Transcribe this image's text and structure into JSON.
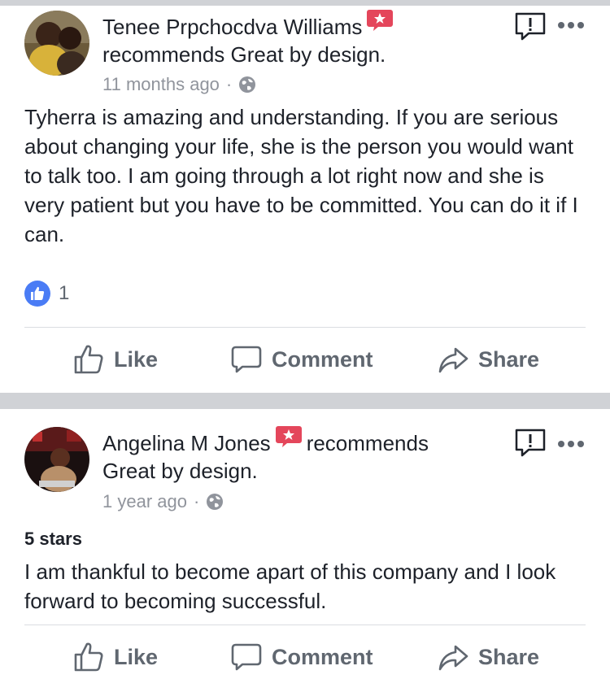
{
  "post1": {
    "author": "Tenee Prpchocdva Williams",
    "recommends_text": "recommends Great by design.",
    "time": "11 months ago",
    "separator": "·",
    "body": "Tyherra is amazing and understanding. If you are serious about changing your life, she is the person you would want to talk too. I am going through a lot right now and she is very patient but you have to be committed. You can do it if I can.",
    "reaction_count": "1"
  },
  "post2": {
    "author": "Angelina M Jones",
    "recommends_text": "recommends",
    "page_name": "Great by design.",
    "time": "1 year ago",
    "separator": "·",
    "rating": "5 stars",
    "body": "I am thankful to become apart of this company and I look forward to becoming successful."
  },
  "actions": {
    "like": "Like",
    "comment": "Comment",
    "share": "Share"
  },
  "colors": {
    "recommend_badge": "#e4465b",
    "like_blue": "#4267b2",
    "muted": "#606770",
    "divider": "#d0d2d6"
  },
  "icons": {
    "recommend": "recommend-badge-icon",
    "globe": "globe-icon",
    "report": "report-icon",
    "more": "more-options-icon",
    "like": "thumbs-up-icon",
    "comment": "comment-bubble-icon",
    "share": "share-arrow-icon"
  }
}
